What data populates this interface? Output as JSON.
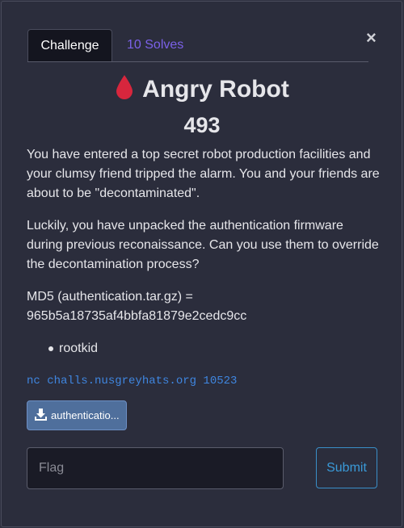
{
  "tabs": {
    "challenge": "Challenge",
    "solves": "10 Solves"
  },
  "close_label": "×",
  "challenge": {
    "title": "Angry Robot",
    "points": "493",
    "description": [
      "You have entered a top secret robot production facilities and your clumsy friend tripped the alarm. You and your friends are about to be \"decontaminated\".",
      "Luckily, you have unpacked the authentication firmware during previous reconaissance. Can you use them to override the decontamination process?",
      "MD5 (authentication.tar.gz) = 965b5a18735af4bbfa81879e2cedc9cc"
    ],
    "authors": [
      "rootkid"
    ],
    "connection": "nc challs.nusgreyhats.org 10523",
    "file_label": "authenticatio..."
  },
  "flag_input": {
    "placeholder": "Flag",
    "value": ""
  },
  "submit_label": "Submit",
  "icons": {
    "title": "blood-drop-icon",
    "file": "download-icon",
    "close": "close-icon"
  },
  "colors": {
    "blood_drop": "#d7263d",
    "solves_tab": "#7b61e8",
    "connection": "#3f86e0",
    "file_button": "#4f6f9c",
    "submit": "#3a9ad8"
  }
}
